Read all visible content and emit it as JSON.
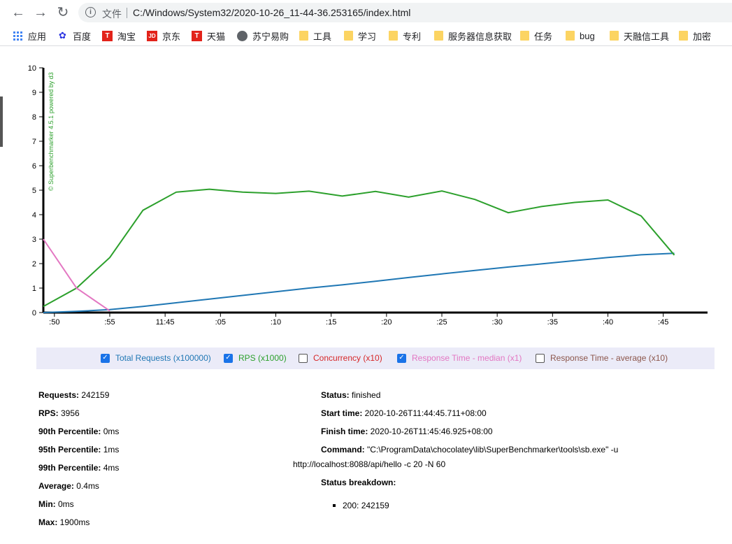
{
  "browser": {
    "scheme_label": "文件",
    "url": "C:/Windows/System32/2020-10-26_11-44-36.253165/index.html"
  },
  "bookmarks": [
    {
      "label": "应用",
      "icon": "apps-grid-icon"
    },
    {
      "label": "百度",
      "icon": "baidu-paw-icon"
    },
    {
      "label": "淘宝",
      "icon": "tmall-t-icon"
    },
    {
      "label": "京东",
      "icon": "jd-icon"
    },
    {
      "label": "天猫",
      "icon": "tmall-t-icon"
    },
    {
      "label": "苏宁易购",
      "icon": "globe-icon"
    },
    {
      "label": "工具",
      "icon": "folder-icon"
    },
    {
      "label": "学习",
      "icon": "folder-icon"
    },
    {
      "label": "专利",
      "icon": "folder-icon"
    },
    {
      "label": "服务器信息获取",
      "icon": "folder-icon"
    },
    {
      "label": "任务",
      "icon": "folder-icon"
    },
    {
      "label": "bug",
      "icon": "folder-icon"
    },
    {
      "label": "天融信工具",
      "icon": "folder-icon"
    },
    {
      "label": "加密",
      "icon": "folder-icon"
    }
  ],
  "chart_data": {
    "type": "line",
    "credit": "© Superbenchmarker 4.5.1 powered by d3",
    "ylim": [
      0,
      10
    ],
    "yticks": [
      "0",
      "1",
      "2",
      "3",
      "4",
      "5",
      "6",
      "7",
      "8",
      "9",
      "10"
    ],
    "xlim": [
      0,
      60
    ],
    "xticks": [
      {
        "t": 1,
        "label": ":50"
      },
      {
        "t": 6,
        "label": ":55"
      },
      {
        "t": 11,
        "label": "11:45"
      },
      {
        "t": 16,
        "label": ":05"
      },
      {
        "t": 21,
        "label": ":10"
      },
      {
        "t": 26,
        "label": ":15"
      },
      {
        "t": 31,
        "label": ":20"
      },
      {
        "t": 36,
        "label": ":25"
      },
      {
        "t": 41,
        "label": ":30"
      },
      {
        "t": 46,
        "label": ":35"
      },
      {
        "t": 51,
        "label": ":40"
      },
      {
        "t": 56,
        "label": ":45"
      }
    ],
    "grid": false,
    "series": [
      {
        "name": "Total Requests (x100000)",
        "color": "#1f77b4",
        "visible": true,
        "points": [
          [
            0,
            0
          ],
          [
            3,
            0.05
          ],
          [
            6,
            0.12
          ],
          [
            9,
            0.25
          ],
          [
            12,
            0.4
          ],
          [
            15,
            0.55
          ],
          [
            18,
            0.7
          ],
          [
            21,
            0.85
          ],
          [
            24,
            1.0
          ],
          [
            27,
            1.13
          ],
          [
            30,
            1.28
          ],
          [
            33,
            1.43
          ],
          [
            36,
            1.58
          ],
          [
            39,
            1.72
          ],
          [
            42,
            1.86
          ],
          [
            45,
            1.99
          ],
          [
            48,
            2.12
          ],
          [
            51,
            2.25
          ],
          [
            54,
            2.36
          ],
          [
            57,
            2.42
          ]
        ]
      },
      {
        "name": "RPS (x1000)",
        "color": "#2ca02c",
        "visible": true,
        "points": [
          [
            0,
            0.25
          ],
          [
            3,
            1.0
          ],
          [
            6,
            2.25
          ],
          [
            9,
            4.18
          ],
          [
            12,
            4.92
          ],
          [
            15,
            5.04
          ],
          [
            18,
            4.92
          ],
          [
            21,
            4.87
          ],
          [
            24,
            4.96
          ],
          [
            27,
            4.76
          ],
          [
            30,
            4.95
          ],
          [
            33,
            4.72
          ],
          [
            36,
            4.97
          ],
          [
            39,
            4.62
          ],
          [
            42,
            4.08
          ],
          [
            45,
            4.33
          ],
          [
            48,
            4.5
          ],
          [
            51,
            4.6
          ],
          [
            54,
            3.95
          ],
          [
            57,
            2.35
          ]
        ]
      },
      {
        "name": "Concurrency (x10)",
        "color": "#d62728",
        "visible": false,
        "points": []
      },
      {
        "name": "Response Time - median (x1)",
        "color": "#e377c2",
        "visible": true,
        "points": [
          [
            0,
            3.0
          ],
          [
            3,
            1.0
          ],
          [
            6,
            0.07
          ]
        ]
      },
      {
        "name": "Response Time - average (x10)",
        "color": "#8c564b",
        "visible": false,
        "points": []
      }
    ]
  },
  "legend": [
    {
      "label": "Total Requests (x100000)",
      "checked": true,
      "color": "#1f77b4"
    },
    {
      "label": "RPS (x1000)",
      "checked": true,
      "color": "#2ca02c"
    },
    {
      "label": "Concurrency (x10)",
      "checked": false,
      "color": "#d62728"
    },
    {
      "label": "Response Time - median (x1)",
      "checked": true,
      "color": "#e377c2"
    },
    {
      "label": "Response Time - average (x10)",
      "checked": false,
      "color": "#8c564b"
    }
  ],
  "stats_left": [
    {
      "key": "Requests:",
      "value": " 242159"
    },
    {
      "key": "RPS:",
      "value": " 3956"
    },
    {
      "key": "90th Percentile:",
      "value": " 0ms"
    },
    {
      "key": "95th Percentile:",
      "value": " 1ms"
    },
    {
      "key": "99th Percentile:",
      "value": " 4ms"
    },
    {
      "key": "Average:",
      "value": " 0.4ms"
    },
    {
      "key": "Min:",
      "value": " 0ms"
    },
    {
      "key": "Max:",
      "value": " 1900ms"
    }
  ],
  "stats_right": {
    "status": {
      "key": "Status:",
      "value": " finished"
    },
    "start": {
      "key": "Start time:",
      "value": " 2020-10-26T11:44:45.711+08:00"
    },
    "finish": {
      "key": "Finish time:",
      "value": " 2020-10-26T11:45:46.925+08:00"
    },
    "command": {
      "key": "Command:",
      "value": " \"C:\\ProgramData\\chocolatey\\lib\\SuperBenchmarker\\tools\\sb.exe\" -u",
      "cont": "http://localhost:8088/api/hello -c 20 -N 60"
    },
    "breakdown": {
      "key": "Status breakdown:",
      "items": [
        "200: 242159"
      ]
    }
  }
}
